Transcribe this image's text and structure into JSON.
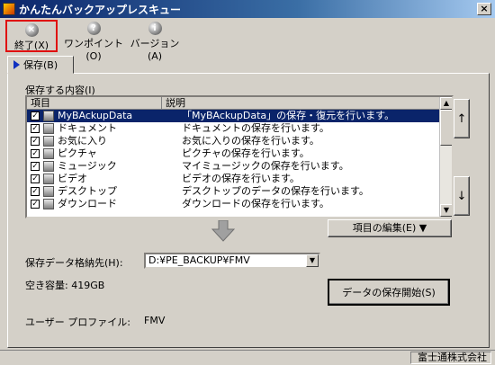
{
  "window": {
    "title": "かんたんバックアップレスキュー",
    "close_label": "×"
  },
  "toolbar": {
    "exit_label": "終了(X)",
    "onepoint_label": "ワンポイント(O)",
    "version_label": "バージョン(A)"
  },
  "tab": {
    "label": "保存(B)"
  },
  "group": {
    "label": "保存する内容(I)"
  },
  "list": {
    "col_item": "項目",
    "col_desc": "説明",
    "rows": [
      {
        "name": "MyBAckupData",
        "desc": "「MyBAckupData」の保存・復元を行います。",
        "checked": true,
        "selected": true
      },
      {
        "name": "ドキュメント",
        "desc": "ドキュメントの保存を行います。",
        "checked": true
      },
      {
        "name": "お気に入り",
        "desc": "お気に入りの保存を行います。",
        "checked": true
      },
      {
        "name": "ピクチャ",
        "desc": "ピクチャの保存を行います。",
        "checked": true
      },
      {
        "name": "ミュージック",
        "desc": "マイミュージックの保存を行います。",
        "checked": true
      },
      {
        "name": "ビデオ",
        "desc": "ビデオの保存を行います。",
        "checked": true
      },
      {
        "name": "デスクトップ",
        "desc": "デスクトップのデータの保存を行います。",
        "checked": true
      },
      {
        "name": "ダウンロード",
        "desc": "ダウンロードの保存を行います。",
        "checked": true
      }
    ]
  },
  "move_up_label": "↑",
  "move_down_label": "↓",
  "edit_button_label": "項目の編集(E) ▼",
  "destination": {
    "label": "保存データ格納先(H):",
    "value": "D:¥PE_BACKUP¥FMV"
  },
  "free_space_label": "空き容量: 419GB",
  "save_button_label": "データの保存開始(S)",
  "user_profile": {
    "label": "ユーザー プロファイル:",
    "value": "FMV"
  },
  "status": {
    "company": "富士通株式会社"
  }
}
